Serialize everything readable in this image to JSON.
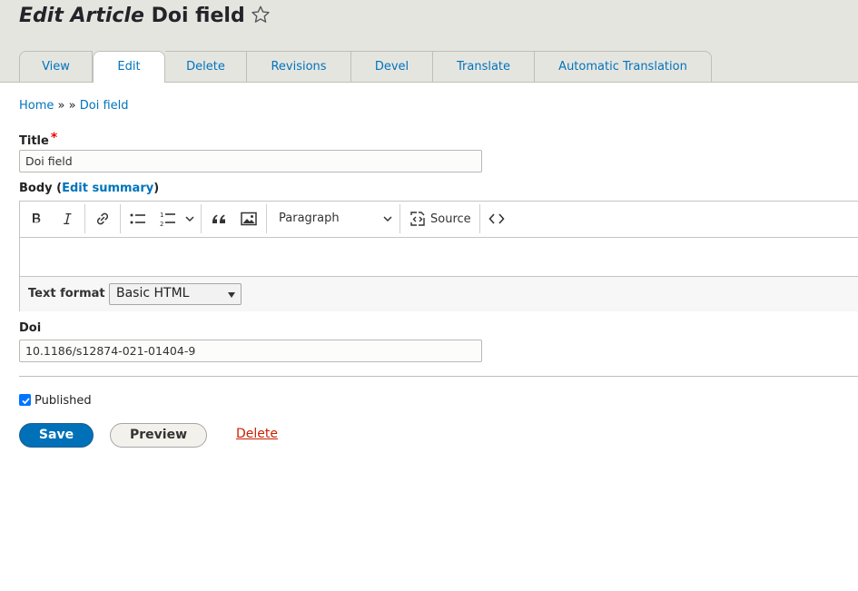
{
  "header": {
    "title_italic": "Edit Article",
    "title_rest": "Doi field"
  },
  "tabs": [
    {
      "label": "View"
    },
    {
      "label": "Edit"
    },
    {
      "label": "Delete"
    },
    {
      "label": "Revisions"
    },
    {
      "label": "Devel"
    },
    {
      "label": "Translate"
    },
    {
      "label": "Automatic Translation"
    }
  ],
  "breadcrumb": {
    "home": "Home",
    "separator": "»",
    "current": "Doi field"
  },
  "form": {
    "title_label": "Title",
    "required_marker": "*",
    "title_value": "Doi field",
    "body_label": "Body",
    "edit_summary": "Edit summary",
    "toolbar": {
      "paragraph": "Paragraph",
      "source": "Source"
    },
    "text_format_label": "Text format",
    "text_format_value": "Basic HTML",
    "doi_label": "Doi",
    "doi_value": "10.1186/s12874-021-01404-9",
    "published_label": "Published",
    "published_checked": true
  },
  "actions": {
    "save": "Save",
    "preview": "Preview",
    "delete": "Delete"
  },
  "icons": {
    "favorite": "star-outline-icon",
    "bold": "bold-icon",
    "italic": "italic-icon",
    "link": "link-icon",
    "bulleted_list": "bulleted-list-icon",
    "numbered_list": "numbered-list-icon",
    "blockquote": "blockquote-icon",
    "image": "image-icon",
    "source": "source-icon",
    "code": "code-icon"
  },
  "colors": {
    "link": "#0074bd",
    "primary_button": "#0071b8",
    "danger": "#c72100",
    "required": "#ee0000"
  }
}
